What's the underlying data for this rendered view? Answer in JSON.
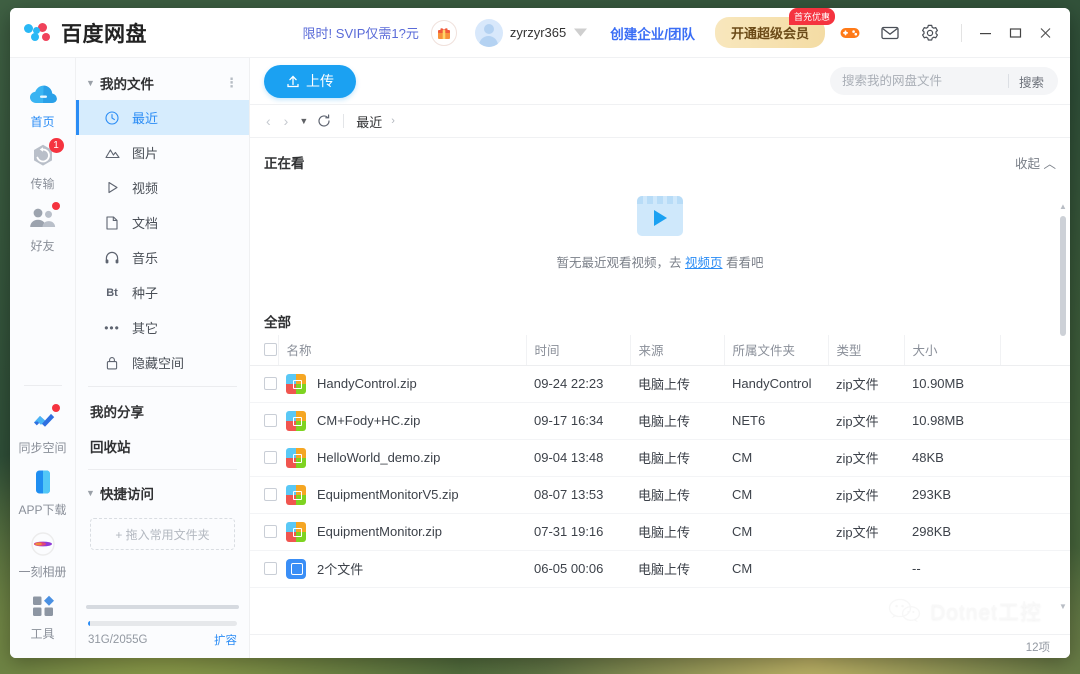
{
  "app": {
    "title": "百度网盘",
    "logo_icon": "baidu-cloud-logo-icon"
  },
  "titlebar": {
    "promo_text": "限时! SVIP仅需1?元",
    "gift_icon": "gift-icon",
    "user_name": "zyrzyr365",
    "vip_chevron_icon": "vip-chevron-icon",
    "create_team_label": "创建企业/团队",
    "svip_label": "开通超级会员",
    "svip_badge": "首充优惠",
    "game_icon": "gamepad-icon",
    "mail_icon": "mail-icon",
    "settings_icon": "gear-icon",
    "minimize_icon": "minimize-icon",
    "maximize_icon": "maximize-icon",
    "close_icon": "close-icon"
  },
  "rail": {
    "items": [
      {
        "label": "首页",
        "icon": "cloud-icon",
        "active": true,
        "badge": ""
      },
      {
        "label": "传输",
        "icon": "transfer-icon",
        "active": false,
        "badge": "1"
      },
      {
        "label": "好友",
        "icon": "friends-icon",
        "active": false,
        "badge": "dot"
      }
    ],
    "items_lower": [
      {
        "label": "同步空间",
        "icon": "sync-space-icon",
        "badge": "dot"
      },
      {
        "label": "APP下载",
        "icon": "phone-app-icon",
        "badge": ""
      },
      {
        "label": "一刻相册",
        "icon": "photo-album-icon",
        "badge": ""
      },
      {
        "label": "工具",
        "icon": "tools-icon",
        "badge": ""
      }
    ]
  },
  "tree": {
    "header": {
      "title": "我的文件",
      "caret_icon": "caret-down-icon",
      "more_icon": "more-vertical-icon"
    },
    "items": [
      {
        "label": "最近",
        "icon": "clock-icon",
        "active": true
      },
      {
        "label": "图片",
        "icon": "image-icon",
        "active": false
      },
      {
        "label": "视频",
        "icon": "play-icon",
        "active": false
      },
      {
        "label": "文档",
        "icon": "document-icon",
        "active": false
      },
      {
        "label": "音乐",
        "icon": "headphone-icon",
        "active": false
      },
      {
        "label": "种子",
        "icon": "bt-icon",
        "active": false
      },
      {
        "label": "其它",
        "icon": "ellipsis-icon",
        "active": false
      },
      {
        "label": "隐藏空间",
        "icon": "lock-icon",
        "active": false
      }
    ],
    "plain_items": [
      {
        "label": "我的分享"
      },
      {
        "label": "回收站"
      }
    ],
    "quick_access": {
      "label": "快捷访问",
      "caret_icon": "caret-down-icon",
      "drop_hint": "+ 拖入常用文件夹"
    },
    "capacity": {
      "text": "31G/2055G",
      "link": "扩容",
      "percent": 1.5
    }
  },
  "toolbar": {
    "upload_label": "上传",
    "upload_icon": "upload-icon",
    "back_icon": "chevron-left-icon",
    "forward_icon": "chevron-right-icon",
    "history_caret_icon": "caret-down-icon",
    "refresh_icon": "refresh-icon",
    "breadcrumb": "最近",
    "breadcrumb_sep": "›"
  },
  "search": {
    "placeholder": "搜索我的网盘文件",
    "value": "",
    "button_label": "搜索",
    "icon": "search-icon"
  },
  "watching_section": {
    "title": "正在看",
    "collapse_label": "收起 ︿",
    "empty_icon": "video-clapper-icon",
    "empty_prefix": "暂无最近观看视频，去 ",
    "empty_link": "视频页",
    "empty_suffix": " 看看吧"
  },
  "all_section": {
    "title": "全部",
    "columns": [
      "名称",
      "时间",
      "来源",
      "所属文件夹",
      "类型",
      "大小"
    ],
    "rows": [
      {
        "icon": "zip-file-icon",
        "name": "HandyControl.zip",
        "time": "09-24 22:23",
        "source": "电脑上传",
        "folder": "HandyControl",
        "type": "zip文件",
        "size": "10.90MB"
      },
      {
        "icon": "zip-file-icon",
        "name": "CM+Fody+HC.zip",
        "time": "09-17 16:34",
        "source": "电脑上传",
        "folder": "NET6",
        "type": "zip文件",
        "size": "10.98MB"
      },
      {
        "icon": "zip-file-icon",
        "name": "HelloWorld_demo.zip",
        "time": "09-04 13:48",
        "source": "电脑上传",
        "folder": "CM",
        "type": "zip文件",
        "size": "48KB"
      },
      {
        "icon": "zip-file-icon",
        "name": "EquipmentMonitorV5.zip",
        "time": "08-07 13:53",
        "source": "电脑上传",
        "folder": "CM",
        "type": "zip文件",
        "size": "293KB"
      },
      {
        "icon": "zip-file-icon",
        "name": "EquipmentMonitor.zip",
        "time": "07-31 19:16",
        "source": "电脑上传",
        "folder": "CM",
        "type": "zip文件",
        "size": "298KB"
      },
      {
        "icon": "folder-file-icon",
        "name": "2个文件",
        "time": "06-05 00:06",
        "source": "电脑上传",
        "folder": "CM",
        "type": "",
        "size": "--"
      }
    ]
  },
  "footer": {
    "count_text": "12项"
  },
  "watermark": {
    "text": "Dotnet工控",
    "icon": "wechat-icon"
  },
  "colors": {
    "accent_blue": "#2a8cf5",
    "upload_blue": "#1ba1f2",
    "badge_red": "#f5333f",
    "svip_gold": "#f4dca4",
    "link_purple": "#5a6bd8"
  }
}
